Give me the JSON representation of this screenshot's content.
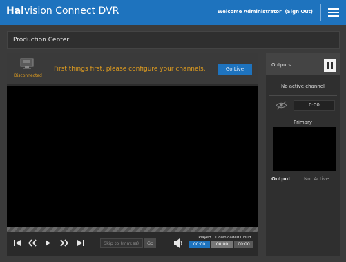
{
  "header": {
    "brand_bold": "Hai",
    "brand_rest": "vision Connect DVR",
    "welcome": "Welcome Administrator",
    "sign_out": "(Sign Out)",
    "menu_icon": "hamburger-icon",
    "color": "#1e73be"
  },
  "page": {
    "title": "Production Center"
  },
  "status": {
    "label": "Disconnected",
    "icon": "monitor-icon",
    "message": "First things first, please configure your channels.",
    "go_live": "Go Live",
    "accent": "#e09d1f"
  },
  "controls": {
    "skip_placeholder": "Skip to (mm:ss)",
    "go": "Go",
    "played_label": "Played",
    "played_value": "00:00",
    "downloaded_label": "Downloaded",
    "downloaded_value": "00:00",
    "cloud_label": "Cloud",
    "cloud_value": "00:00",
    "icons": [
      "skip-back-icon",
      "rewind-icon",
      "play-icon",
      "fast-forward-icon",
      "skip-forward-icon",
      "speaker-icon"
    ]
  },
  "outputs": {
    "title": "Outputs",
    "no_active": "No active channel",
    "time": "0:00",
    "primary": "Primary",
    "output_label": "Output",
    "output_status": "Not Active",
    "icons": [
      "pause-icon",
      "eye-off-icon"
    ]
  }
}
